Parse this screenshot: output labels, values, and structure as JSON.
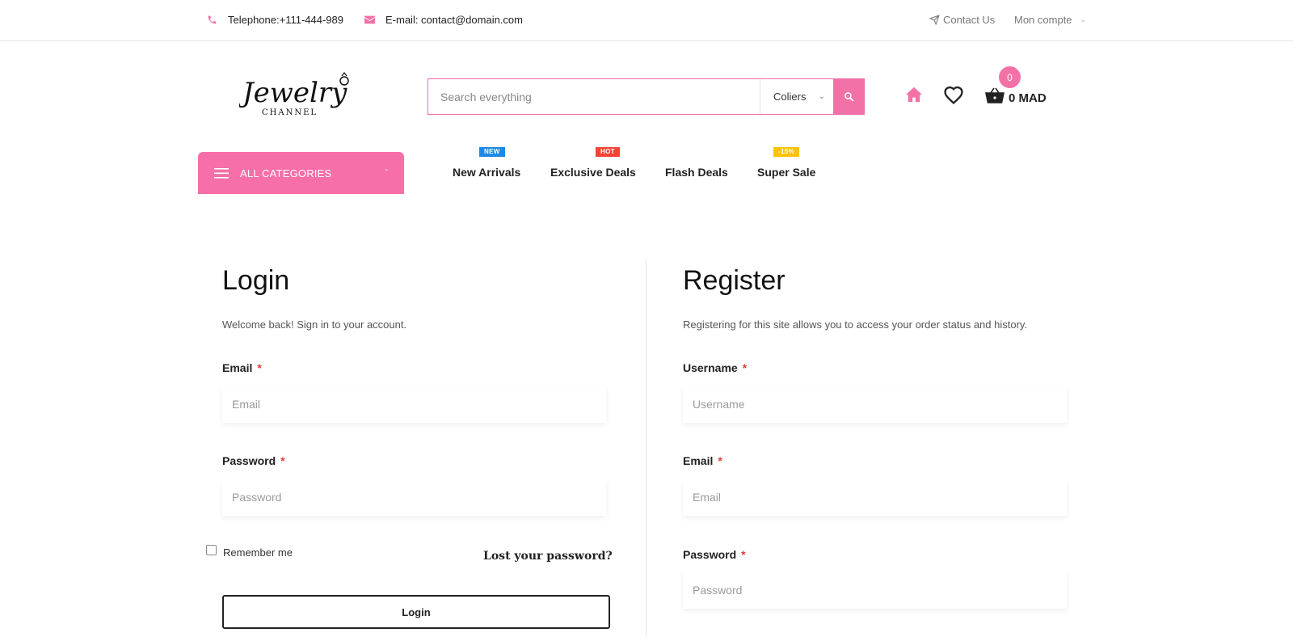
{
  "topbar": {
    "phone": "Telephone:+111-444-989",
    "email": "E-mail: contact@domain.com",
    "contact": "Contact Us",
    "account": "Mon compte"
  },
  "header": {
    "search_placeholder": "Search everything",
    "category_selected": "Coliers",
    "cart_count": "0",
    "cart_total": "0 MAD"
  },
  "nav": {
    "all_categories": "ALL CATEGORIES",
    "items": [
      {
        "label": "New Arrivals",
        "badge": "NEW"
      },
      {
        "label": "Exclusive Deals",
        "badge": "HOT"
      },
      {
        "label": "Flash Deals",
        "badge": ""
      },
      {
        "label": "Super Sale",
        "badge": "-15%"
      }
    ]
  },
  "login": {
    "title": "Login",
    "subtitle": "Welcome back! Sign in to your account.",
    "email_label": "Email",
    "email_placeholder": "Email",
    "password_label": "Password",
    "password_placeholder": "Password",
    "required_mark": "*",
    "remember": "Remember me",
    "lost_password": "Lost your password?",
    "button": "Login"
  },
  "register": {
    "title": "Register",
    "subtitle": "Registering for this site allows you to access your order status and history.",
    "username_label": "Username",
    "username_placeholder": "Username",
    "email_label": "Email",
    "email_placeholder": "Email",
    "password_label": "Password",
    "password_placeholder": "Password",
    "required_mark": "*"
  },
  "colors": {
    "accent": "#f272a8",
    "badge_new": "#1e88e5",
    "badge_hot": "#f44336",
    "badge_sale": "#ffc107"
  }
}
